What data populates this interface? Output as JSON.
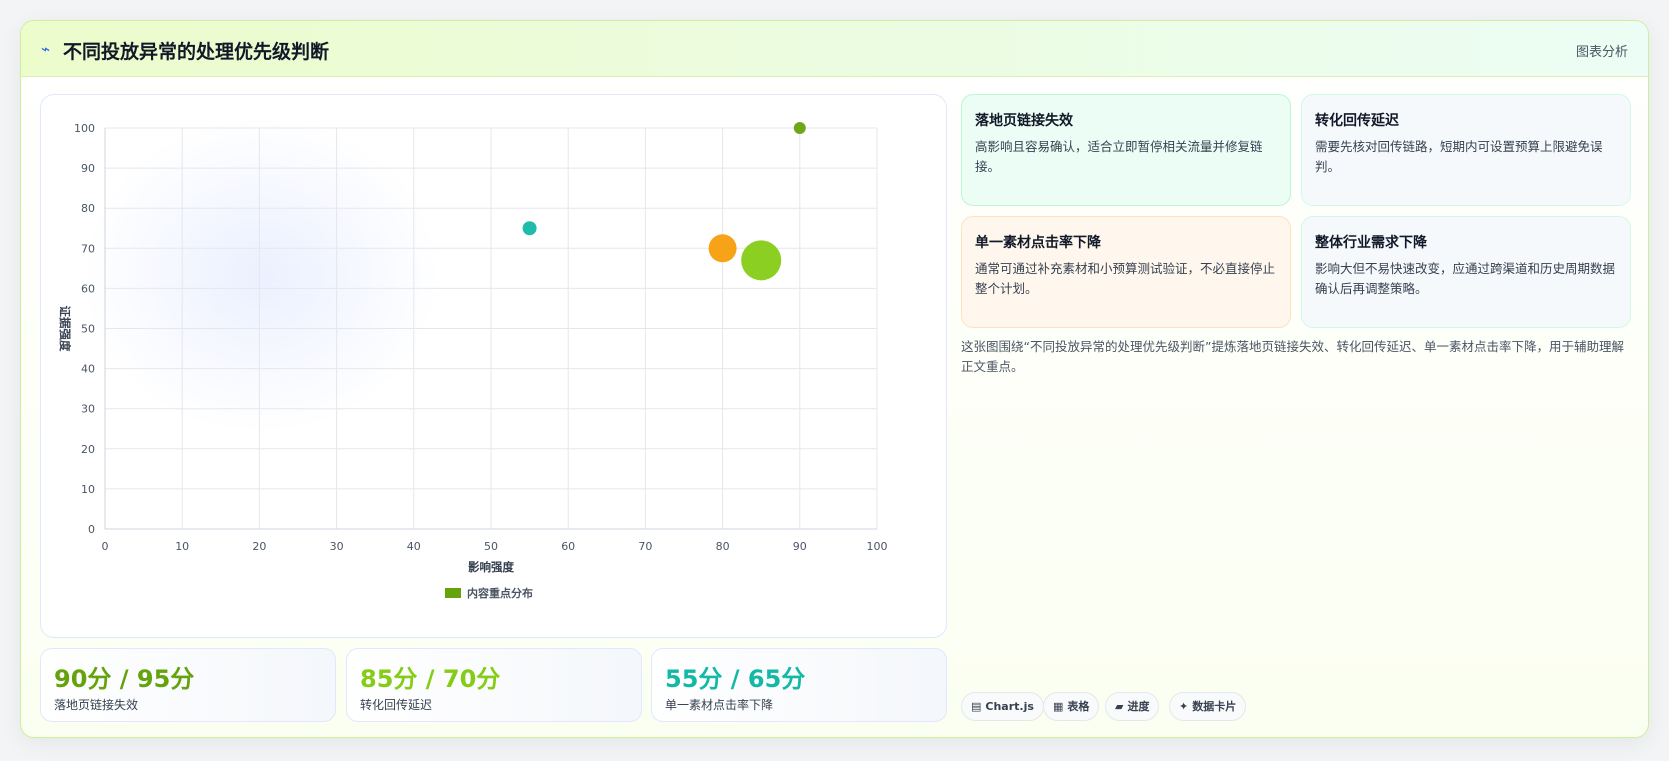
{
  "header": {
    "icon": "lightning-icon",
    "title": "不同投放异常的处理优先级判断",
    "tag": "图表分析"
  },
  "chart_data": {
    "type": "scatter",
    "xlabel": "影响强度",
    "ylabel": "证据强度",
    "xlim": [
      0,
      100
    ],
    "ylim": [
      0,
      100
    ],
    "xticks": [
      0,
      10,
      20,
      30,
      40,
      50,
      60,
      70,
      80,
      90,
      100
    ],
    "yticks": [
      0,
      10,
      20,
      30,
      40,
      50,
      60,
      70,
      80,
      90,
      100
    ],
    "grid": true,
    "legend_position": "bottom",
    "series": [
      {
        "name": "内容重点分布",
        "points": [
          {
            "x": 90,
            "y": 100,
            "r": 6,
            "color": "#65a30d"
          },
          {
            "x": 55,
            "y": 75,
            "r": 7,
            "color": "#14b8a6"
          },
          {
            "x": 80,
            "y": 70,
            "r": 14,
            "color": "#f59e0b"
          },
          {
            "x": 85,
            "y": 67,
            "r": 20,
            "color": "#84cc16"
          }
        ]
      }
    ],
    "legend_color": "#65a30d"
  },
  "stats": [
    {
      "value": "90分 / 95分",
      "label": "落地页链接失效",
      "color": "#65a30d"
    },
    {
      "value": "85分 / 70分",
      "label": "转化回传延迟",
      "color": "#84cc16"
    },
    {
      "value": "55分 / 65分",
      "label": "单一素材点击率下降",
      "color": "#14b8a6"
    }
  ],
  "cards": [
    {
      "title": "落地页链接失效",
      "body": "高影响且容易确认，适合立即暂停相关流量并修复链接。",
      "bg": "#ecfdf5",
      "border": "#bbf7d0"
    },
    {
      "title": "转化回传延迟",
      "body": "需要先核对回传链路，短期内可设置预算上限避免误判。",
      "bg": "#f6f9fc",
      "border": "#d1fae5"
    },
    {
      "title": "单一素材点击率下降",
      "body": "通常可通过补充素材和小预算测试验证，不必直接停止整个计划。",
      "bg": "#fff7ed",
      "border": "#fde2c0"
    },
    {
      "title": "整体行业需求下降",
      "body": "影响大但不易快速改变，应通过跨渠道和历史周期数据确认后再调整策略。",
      "bg": "#f6f9fc",
      "border": "#d1fae5"
    }
  ],
  "description": "这张图围绕“不同投放异常的处理优先级判断”提炼落地页链接失效、转化回传延迟、单一素材点击率下降，用于辅助理解正文重点。",
  "chips": [
    {
      "icon": "chart-icon",
      "glyph": "▤",
      "label": "Chart.js"
    },
    {
      "icon": "table-icon",
      "glyph": "▦",
      "label": "表格"
    },
    {
      "icon": "progress-icon",
      "glyph": "▰",
      "label": "进度"
    },
    {
      "icon": "sparkle-icon",
      "glyph": "✦",
      "label": "数据卡片"
    }
  ]
}
